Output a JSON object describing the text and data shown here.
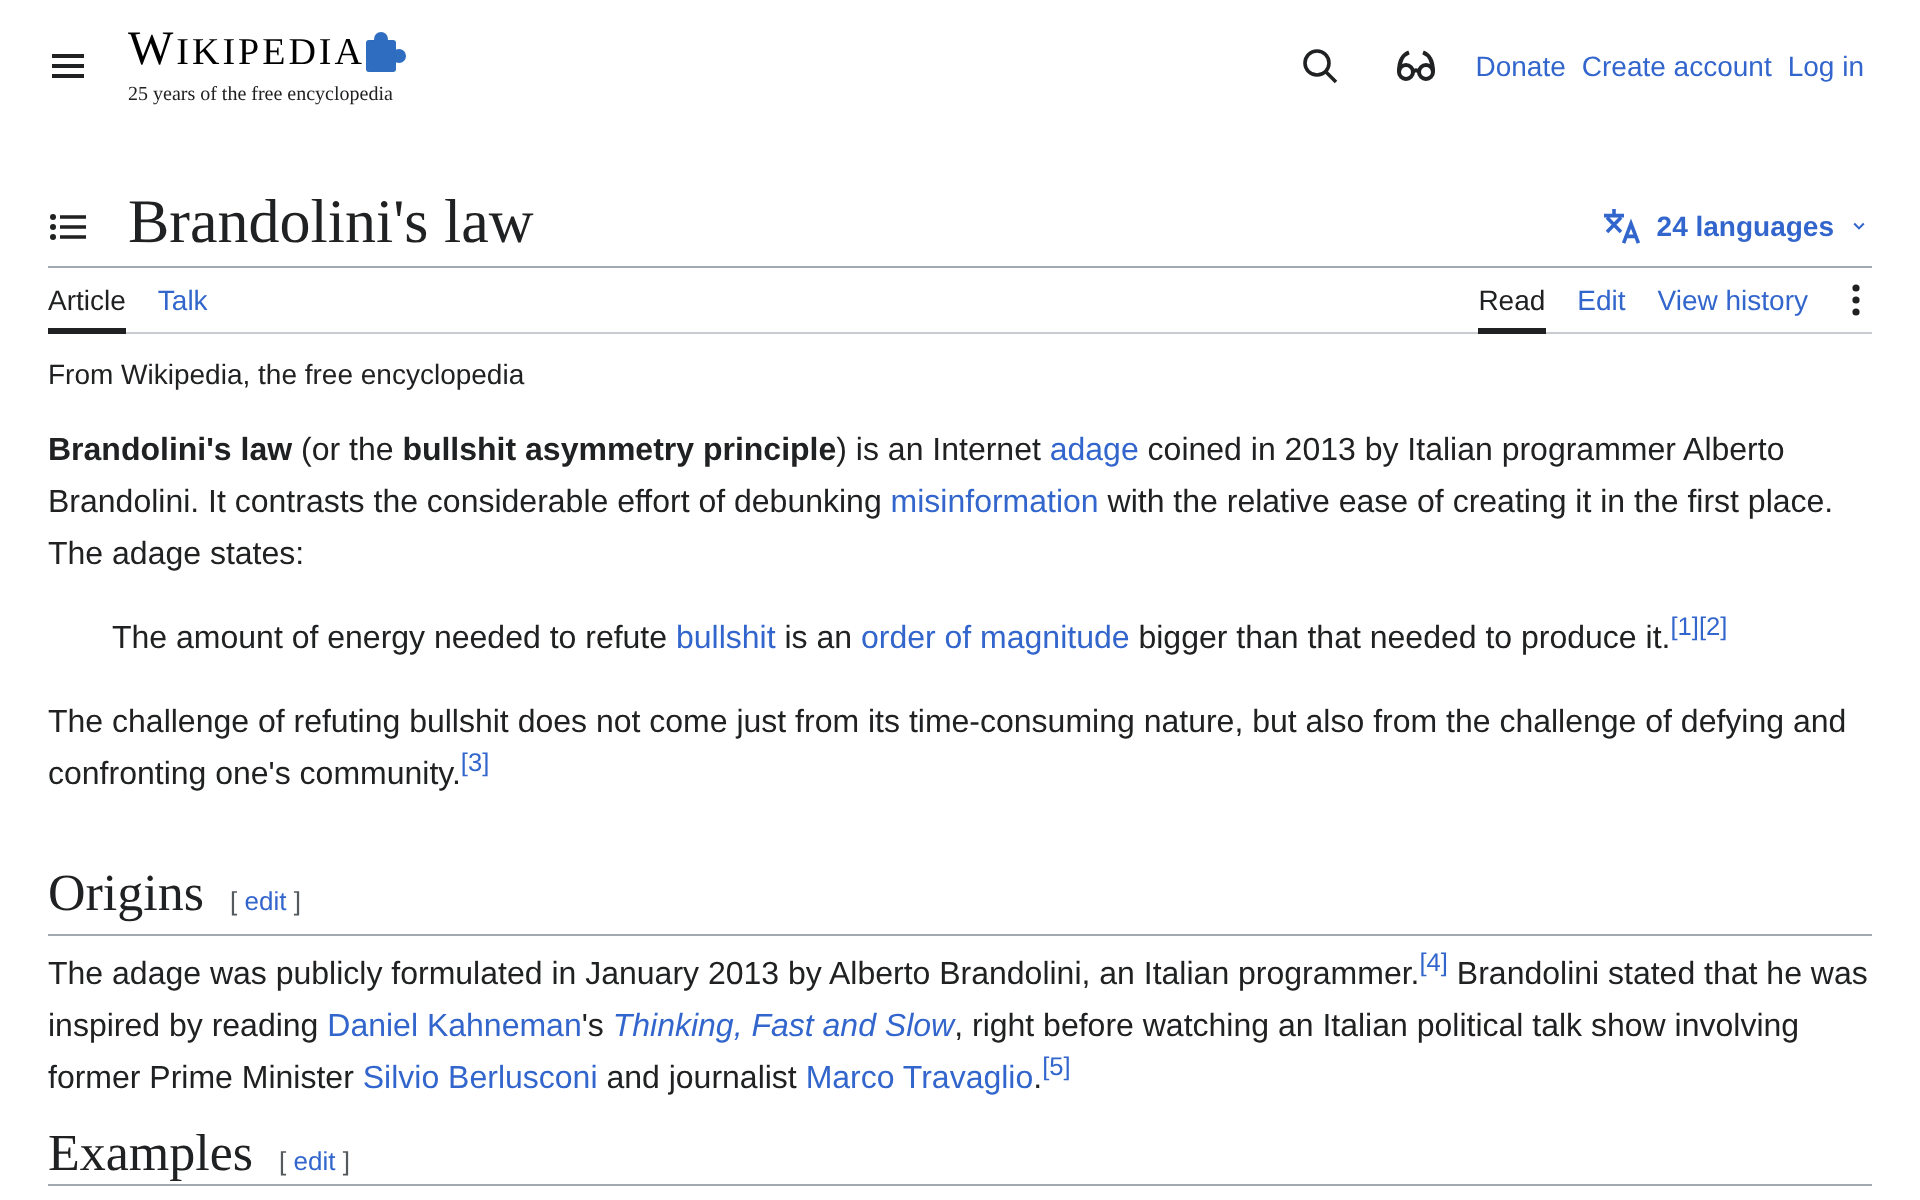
{
  "header": {
    "logo": {
      "wordmark": "WIKIPEDIA",
      "tagline": "25 years of the free encyclopedia"
    },
    "links": [
      "Donate",
      "Create account",
      "Log in"
    ]
  },
  "title": "Brandolini's law",
  "languages": "24 languages",
  "namespace_tabs": [
    {
      "label": "Article",
      "selected": true
    },
    {
      "label": "Talk",
      "selected": false
    }
  ],
  "view_tabs": [
    {
      "label": "Read",
      "selected": true
    },
    {
      "label": "Edit",
      "selected": false
    },
    {
      "label": "View history",
      "selected": false
    }
  ],
  "site_sub": "From Wikipedia, the free encyclopedia",
  "content": [
    {
      "kind": "paragraph",
      "segments": [
        {
          "kind": "bold",
          "text": "Brandolini's law"
        },
        {
          "kind": "text",
          "text": " (or the "
        },
        {
          "kind": "bold",
          "text": "bullshit asymmetry principle"
        },
        {
          "kind": "text",
          "text": ") is an Internet "
        },
        {
          "kind": "link",
          "text": "adage"
        },
        {
          "kind": "text",
          "text": " coined in 2013 by Italian programmer Alberto Brandolini. It contrasts the considerable effort of debunking "
        },
        {
          "kind": "link",
          "text": "misinformation"
        },
        {
          "kind": "text",
          "text": " with the relative ease of creating it in the first place. The adage states:"
        }
      ]
    },
    {
      "kind": "quote",
      "segments": [
        {
          "kind": "text",
          "text": "The amount of energy needed to refute "
        },
        {
          "kind": "link",
          "text": "bullshit"
        },
        {
          "kind": "text",
          "text": " is an "
        },
        {
          "kind": "link",
          "text": "order of magnitude"
        },
        {
          "kind": "text",
          "text": " bigger than that needed to produce it."
        },
        {
          "kind": "ref",
          "text": "[1]"
        },
        {
          "kind": "ref",
          "text": "[2]"
        }
      ]
    },
    {
      "kind": "paragraph",
      "segments": [
        {
          "kind": "text",
          "text": "The challenge of refuting bullshit does not come just from its time-consuming nature, but also from the challenge of defying and confronting one's community."
        },
        {
          "kind": "ref",
          "text": "[3]"
        }
      ]
    },
    {
      "kind": "heading",
      "title": "Origins",
      "edit": {
        "open": "[",
        "label": "edit",
        "close": "]"
      }
    },
    {
      "kind": "paragraph",
      "segments": [
        {
          "kind": "text",
          "text": "The adage was publicly formulated in January 2013 by Alberto Brandolini, an Italian programmer."
        },
        {
          "kind": "ref",
          "text": "[4]"
        },
        {
          "kind": "text",
          "text": " Brandolini stated that he was inspired by reading "
        },
        {
          "kind": "link",
          "text": "Daniel Kahneman"
        },
        {
          "kind": "text",
          "text": "'s "
        },
        {
          "kind": "italic_link",
          "text": "Thinking, Fast and Slow"
        },
        {
          "kind": "text",
          "text": ", right before watching an Italian political talk show involving former Prime Minister "
        },
        {
          "kind": "link",
          "text": "Silvio Berlusconi"
        },
        {
          "kind": "text",
          "text": " and journalist "
        },
        {
          "kind": "link",
          "text": "Marco Travaglio"
        },
        {
          "kind": "text",
          "text": "."
        },
        {
          "kind": "ref",
          "text": "[5]"
        }
      ]
    },
    {
      "kind": "heading",
      "title": "Examples",
      "edit": {
        "open": "[",
        "label": "edit",
        "close": "]"
      }
    }
  ]
}
